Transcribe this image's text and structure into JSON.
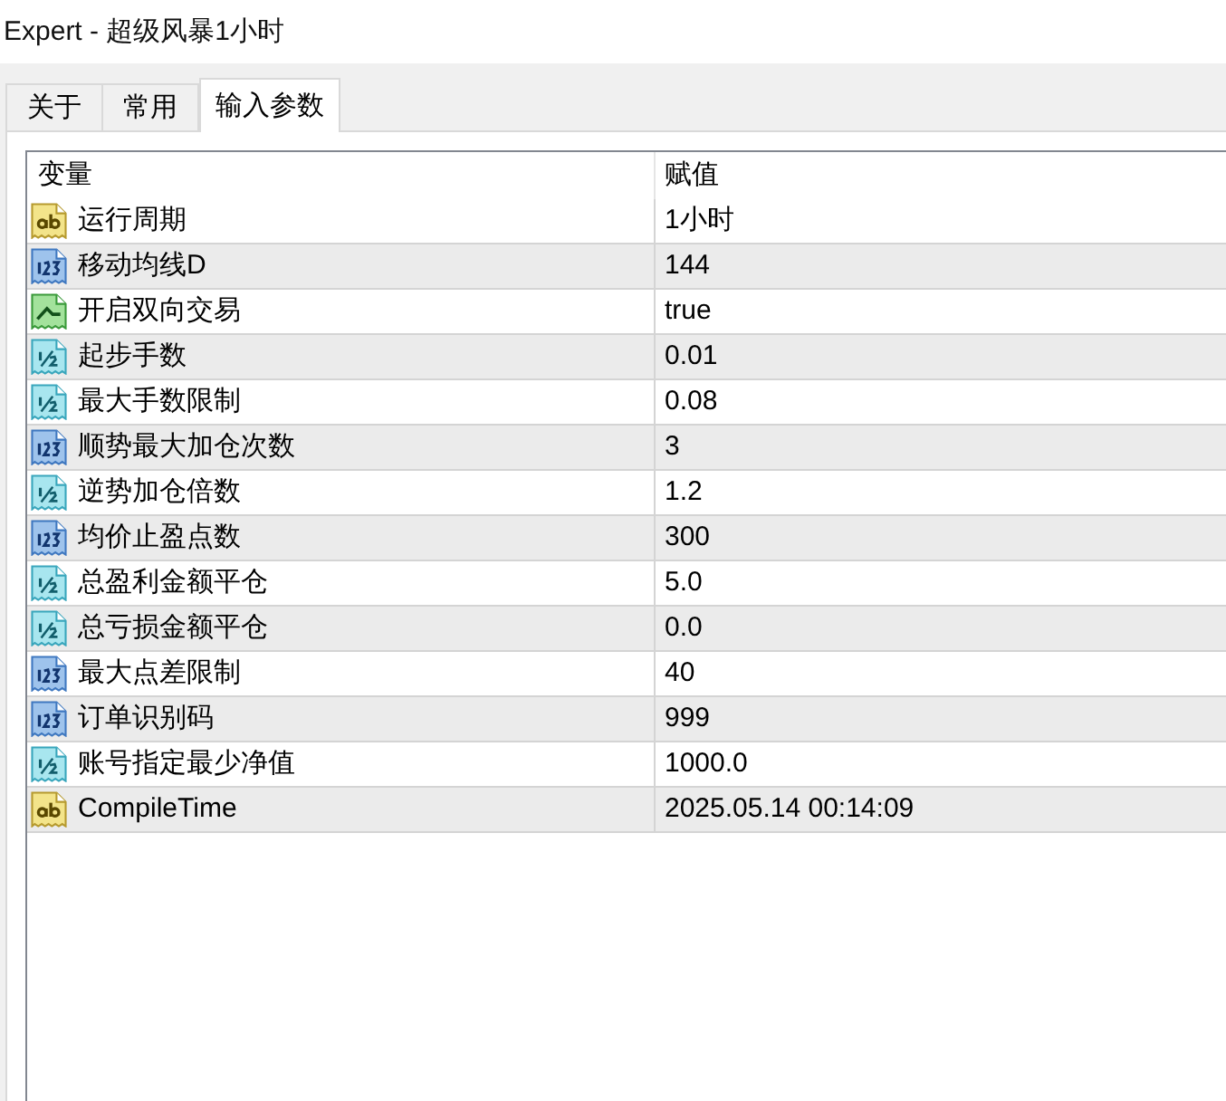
{
  "window": {
    "title": "Expert - 超级风暴1小时"
  },
  "tabs": [
    {
      "label": "关于",
      "selected": false
    },
    {
      "label": "常用",
      "selected": false
    },
    {
      "label": "输入参数",
      "selected": true
    }
  ],
  "table": {
    "columns": [
      "变量",
      "赋值"
    ],
    "rows": [
      {
        "kind": "string",
        "name": "运行周期",
        "value": "1小时"
      },
      {
        "kind": "integer",
        "name": "移动均线D",
        "value": "144"
      },
      {
        "kind": "boolean",
        "name": "开启双向交易",
        "value": "true"
      },
      {
        "kind": "double",
        "name": "起步手数",
        "value": "0.01"
      },
      {
        "kind": "double",
        "name": "最大手数限制",
        "value": "0.08"
      },
      {
        "kind": "integer",
        "name": "顺势最大加仓次数",
        "value": "3"
      },
      {
        "kind": "double",
        "name": "逆势加仓倍数",
        "value": "1.2"
      },
      {
        "kind": "integer",
        "name": "均价止盈点数",
        "value": "300"
      },
      {
        "kind": "double",
        "name": "总盈利金额平仓",
        "value": "5.0"
      },
      {
        "kind": "double",
        "name": "总亏损金额平仓",
        "value": "0.0"
      },
      {
        "kind": "integer",
        "name": "最大点差限制",
        "value": "40"
      },
      {
        "kind": "integer",
        "name": "订单识别码",
        "value": "999"
      },
      {
        "kind": "double",
        "name": "账号指定最少净值",
        "value": "1000.0"
      },
      {
        "kind": "string",
        "name": "CompileTime",
        "value": "2025.05.14 00:14:09"
      }
    ]
  }
}
